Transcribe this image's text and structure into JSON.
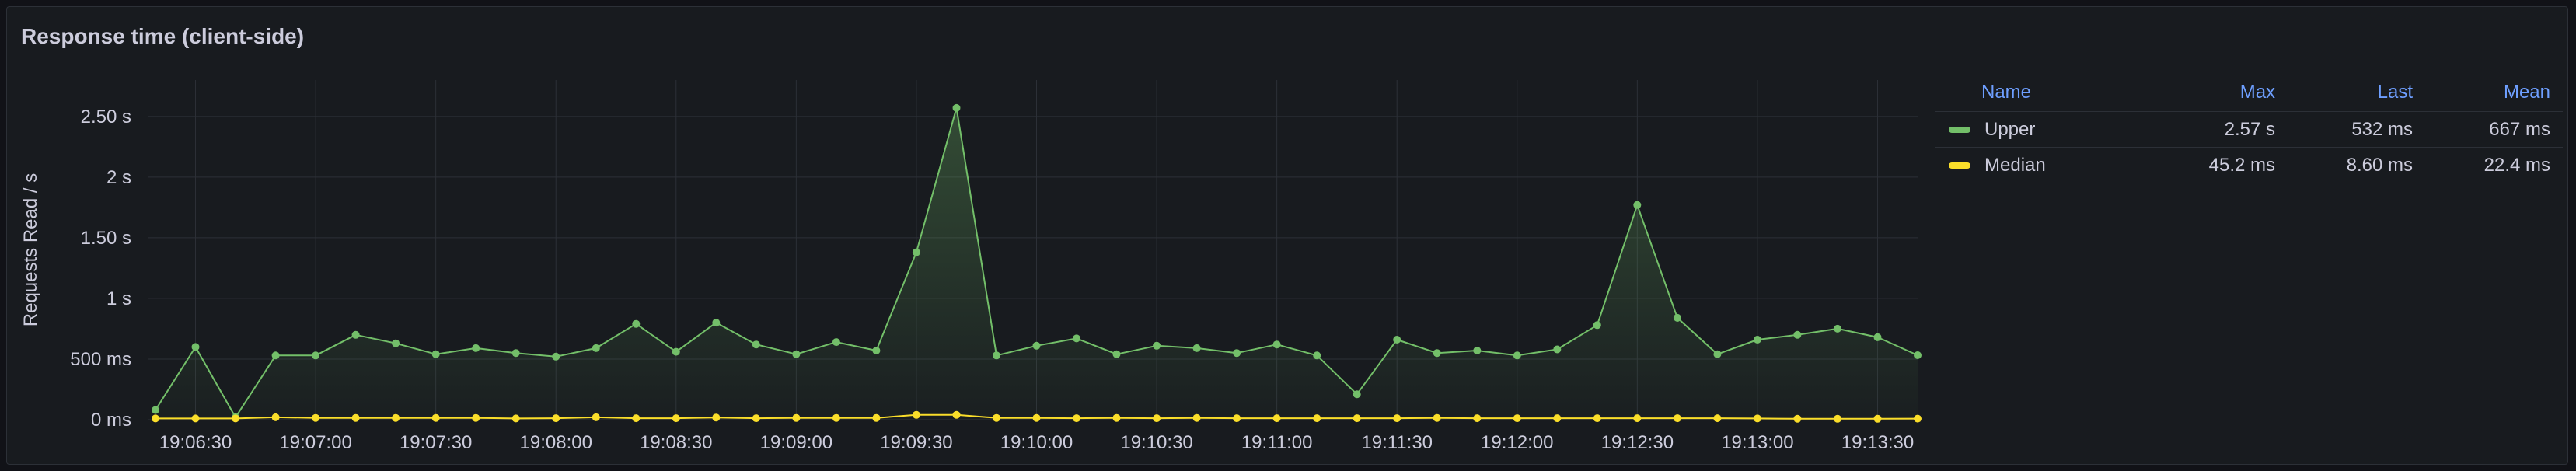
{
  "panel": {
    "title": "Response time (client-side)"
  },
  "colors": {
    "Upper": "#73bf69",
    "Median": "#fade2a",
    "legend_header": "#6e9fff",
    "grid": "#2c3037"
  },
  "legend": {
    "columns": [
      "Name",
      "Max",
      "Last",
      "Mean"
    ],
    "rows": [
      {
        "name": "Upper",
        "max": "2.57 s",
        "last": "532 ms",
        "mean": "667 ms"
      },
      {
        "name": "Median",
        "max": "45.2 ms",
        "last": "8.60 ms",
        "mean": "22.4 ms"
      }
    ]
  },
  "chart_data": {
    "type": "area",
    "title": "Response time (client-side)",
    "ylabel": "Requests Read / s",
    "xlabel": "",
    "ylim_ms": [
      0,
      2800
    ],
    "y_ticks": [
      {
        "value_ms": 0,
        "label": "0 ms"
      },
      {
        "value_ms": 500,
        "label": "500 ms"
      },
      {
        "value_ms": 1000,
        "label": "1 s"
      },
      {
        "value_ms": 1500,
        "label": "1.50 s"
      },
      {
        "value_ms": 2000,
        "label": "2 s"
      },
      {
        "value_ms": 2500,
        "label": "2.50 s"
      }
    ],
    "x_ticks": [
      "19:06:30",
      "19:07:00",
      "19:07:30",
      "19:08:00",
      "19:08:30",
      "19:09:00",
      "19:09:30",
      "19:10:00",
      "19:10:30",
      "19:11:00",
      "19:11:30",
      "19:12:00",
      "19:12:30",
      "19:13:00",
      "19:13:30"
    ],
    "x_start": "19:06:20",
    "x_step_seconds": 10,
    "grid": true,
    "legend_placement": "right",
    "series": [
      {
        "name": "Upper",
        "values_ms": [
          80,
          600,
          20,
          530,
          530,
          700,
          630,
          540,
          590,
          550,
          520,
          590,
          790,
          560,
          800,
          620,
          540,
          640,
          570,
          1380,
          2570,
          530,
          610,
          670,
          540,
          610,
          590,
          550,
          620,
          530,
          210,
          660,
          550,
          570,
          530,
          580,
          780,
          1770,
          840,
          540,
          660,
          700,
          750,
          680,
          532
        ]
      },
      {
        "name": "Median",
        "values_ms": [
          10,
          10,
          10,
          20,
          15,
          15,
          15,
          15,
          15,
          10,
          12,
          20,
          12,
          12,
          18,
          12,
          15,
          15,
          15,
          40,
          40,
          15,
          15,
          12,
          15,
          12,
          15,
          12,
          12,
          12,
          12,
          12,
          15,
          12,
          12,
          12,
          12,
          12,
          12,
          12,
          10,
          8,
          8,
          8,
          9
        ]
      }
    ]
  }
}
